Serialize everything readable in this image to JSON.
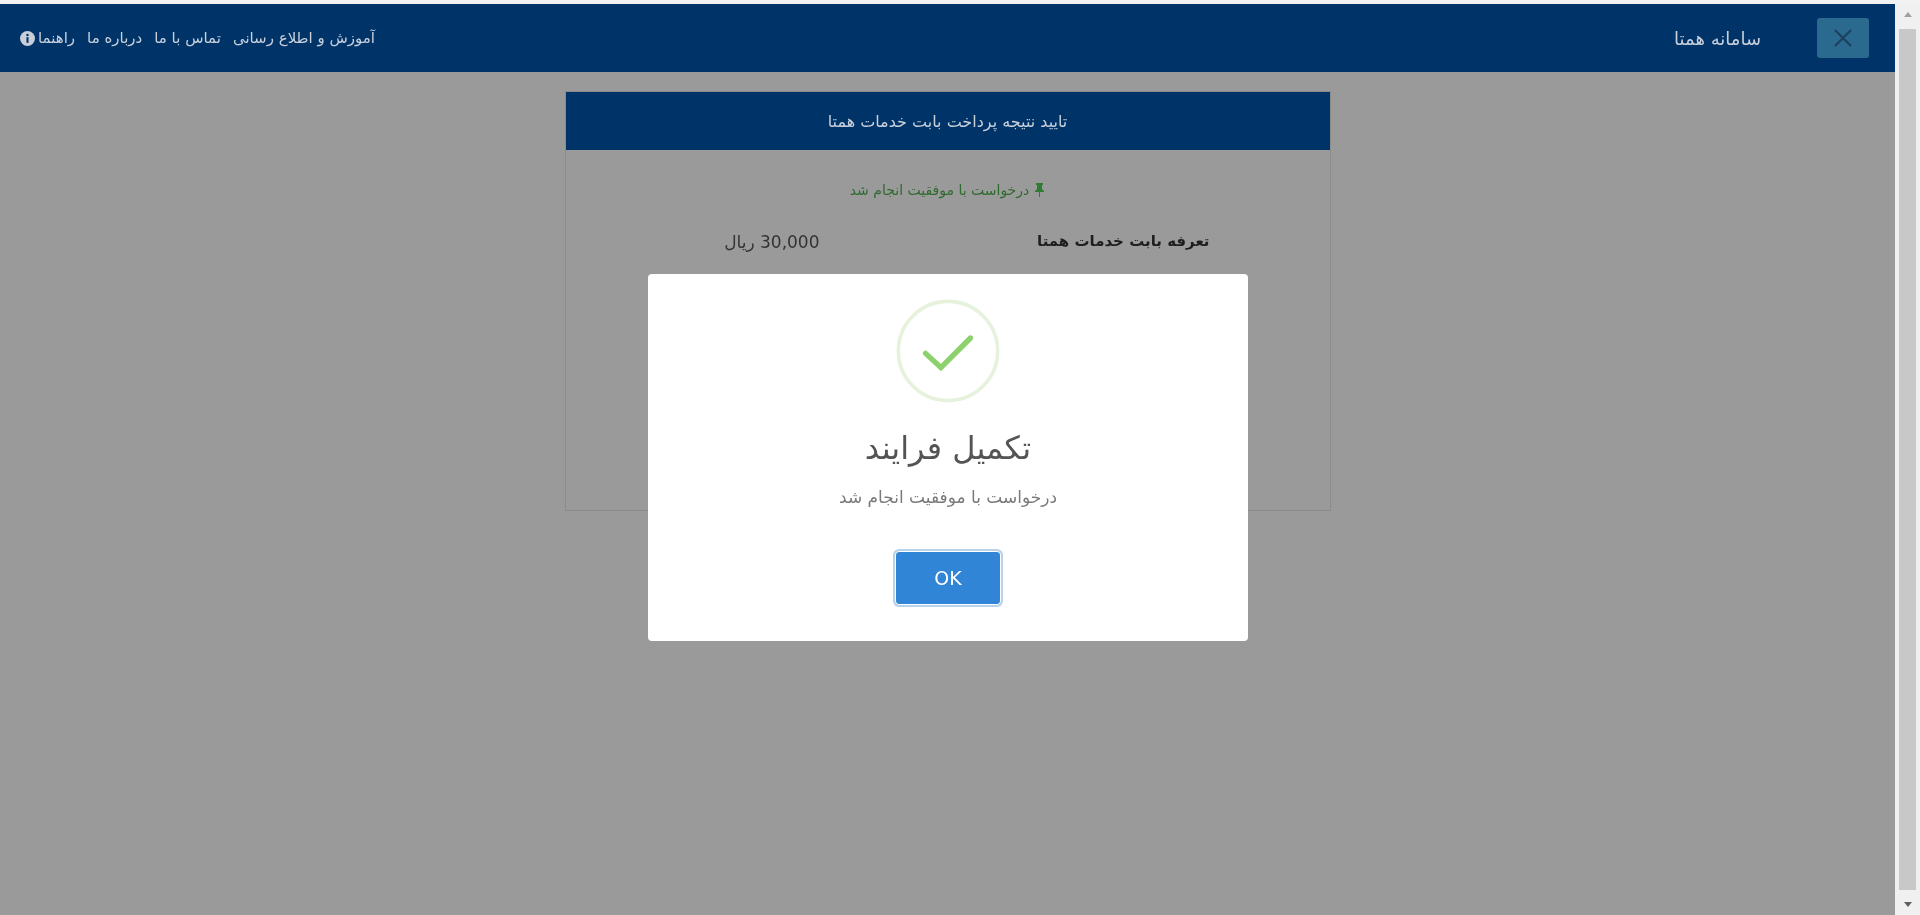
{
  "header": {
    "brand": "سامانه همتا",
    "nav": [
      {
        "label": "آموزش و اطلاع رسانی",
        "kind": "link"
      },
      {
        "label": "تماس با ما",
        "kind": "link"
      },
      {
        "label": "درباره ما",
        "kind": "link"
      },
      {
        "label": "راهنما",
        "kind": "help"
      }
    ]
  },
  "card": {
    "title": "تایید نتیجه پرداخت بابت خدمات همتا",
    "message": "درخواست با موفقیت انجام شد",
    "rows": [
      {
        "label": "تعرفه بابت خدمات همتا",
        "value": "30,000 ریال"
      }
    ]
  },
  "dialog": {
    "title": "تکمیل فرایند",
    "text": "درخواست با موفقیت انجام شد",
    "button": "OK"
  }
}
